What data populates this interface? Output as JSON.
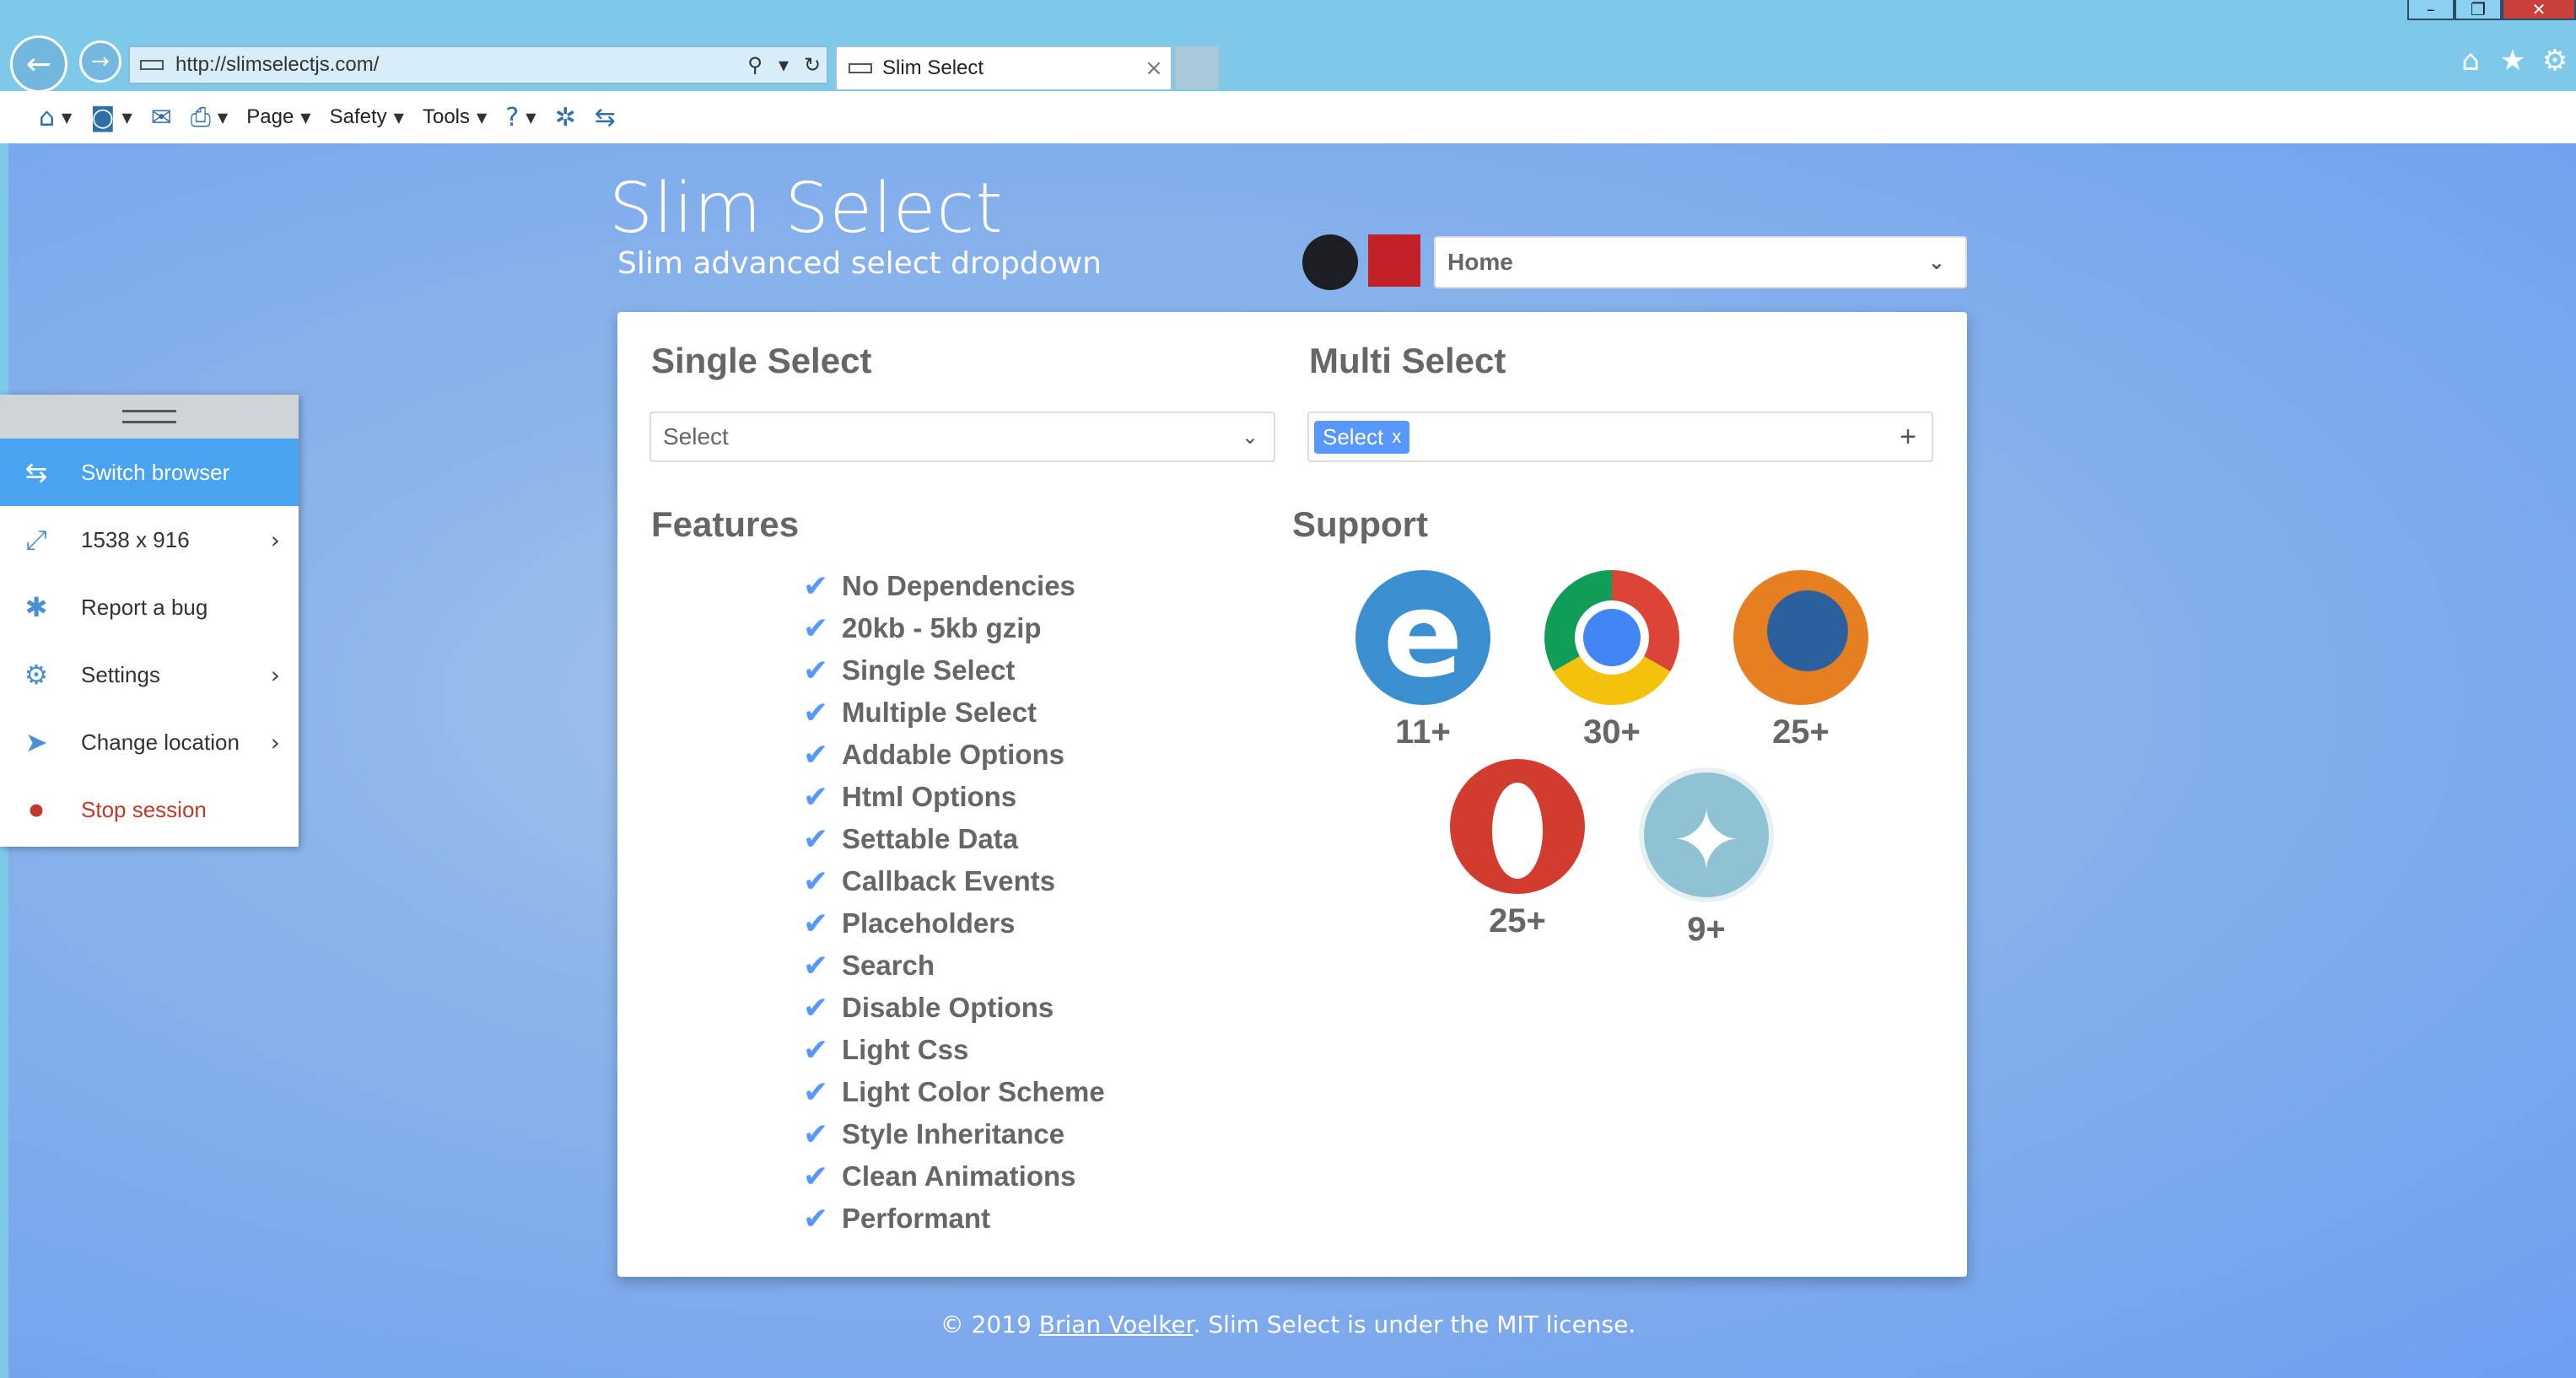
{
  "browser": {
    "url": "http://slimselectjs.com/",
    "tab_title": "Slim Select",
    "tab_close": "×",
    "window_controls": [
      "–",
      "❐",
      "✕"
    ],
    "toolbar": {
      "page": "Page",
      "safety": "Safety",
      "tools": "Tools"
    }
  },
  "header": {
    "title": "Slim Select",
    "subtitle": "Slim advanced select dropdown",
    "nav_select_value": "Home"
  },
  "single_select": {
    "heading": "Single Select",
    "placeholder": "Select"
  },
  "multi_select": {
    "heading": "Multi Select",
    "chip_label": "Select",
    "chip_remove": "x",
    "add_symbol": "+"
  },
  "features": {
    "heading": "Features",
    "items": [
      "No Dependencies",
      "20kb - 5kb gzip",
      "Single Select",
      "Multiple Select",
      "Addable Options",
      "Html Options",
      "Settable Data",
      "Callback Events",
      "Placeholders",
      "Search",
      "Disable Options",
      "Light Css",
      "Light Color Scheme",
      "Style Inheritance",
      "Clean Animations",
      "Performant"
    ]
  },
  "support": {
    "heading": "Support",
    "browsers": [
      {
        "icon": "internet-explorer-icon",
        "version": "11+"
      },
      {
        "icon": "chrome-icon",
        "version": "30+"
      },
      {
        "icon": "firefox-icon",
        "version": "25+"
      },
      {
        "icon": "opera-icon",
        "version": "25+"
      },
      {
        "icon": "safari-icon",
        "version": "9+"
      }
    ]
  },
  "footer": {
    "prefix": "© 2019 ",
    "author": "Brian Voelker",
    "suffix": ". Slim Select is under the MIT license."
  },
  "side_menu": {
    "items": [
      {
        "label": "Switch browser",
        "icon": "switch-arrows-icon"
      },
      {
        "label": "1538 x 916",
        "icon": "resize-icon"
      },
      {
        "label": "Report a bug",
        "icon": "bug-icon"
      },
      {
        "label": "Settings",
        "icon": "gear-icon"
      },
      {
        "label": "Change location",
        "icon": "location-arrow-icon"
      },
      {
        "label": "Stop session",
        "icon": "stop-icon"
      }
    ]
  },
  "colors": {
    "accent": "#5897fb",
    "menu_active": "#4aa3f0",
    "stop": "#c0392b"
  }
}
